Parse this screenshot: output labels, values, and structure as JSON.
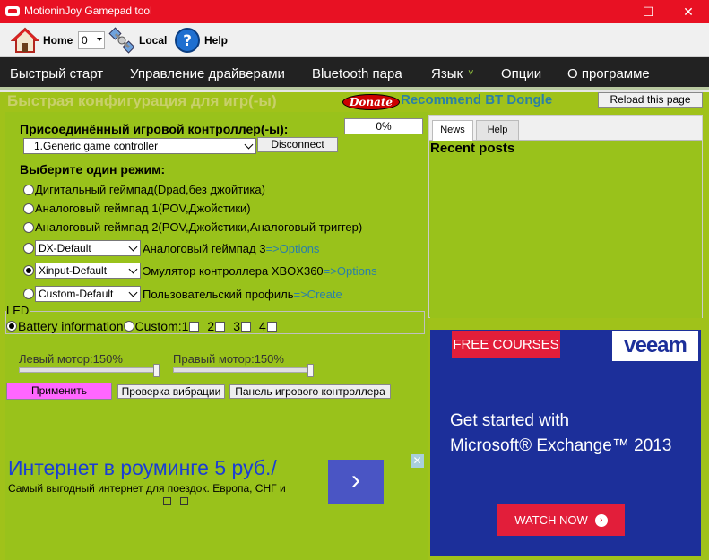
{
  "window": {
    "title": "MotioninJoy Gamepad tool",
    "controls": {
      "minimize": "—",
      "maximize": "☐",
      "close": "✕"
    }
  },
  "toolbar": {
    "home_label": "Home",
    "index_value": "0",
    "local_label": "Local",
    "help_label": "Help"
  },
  "menu": [
    {
      "label": "Быстрый старт"
    },
    {
      "label": "Управление драйверами"
    },
    {
      "label": "Bluetooth пара"
    },
    {
      "label": "Язык"
    },
    {
      "label": "Опции"
    },
    {
      "label": "О программе"
    }
  ],
  "header": {
    "heading": "Быстрая конфигурация для игр(-ы)",
    "donate_label": "Donate",
    "recommend_label": "Recommend BT Dongle",
    "reload_label": "Reload this page"
  },
  "controller": {
    "section_label": "Присоединённый игровой контроллер(-ы):",
    "selected": "1.Generic game controller",
    "disconnect_label": "Disconnect",
    "progress_percent": 0,
    "progress_text": "0%"
  },
  "mode": {
    "section_label": "Выберите один режим:",
    "options": [
      {
        "label": "Дигитальный геймпад(Dpad,без джойтика)",
        "checked": false
      },
      {
        "label": "Аналоговый геймпад 1(POV,Джойстики)",
        "checked": false
      },
      {
        "label": "Аналоговый геймпад 2(POV,Джойстики,Аналоговый триггер)",
        "checked": false
      }
    ],
    "dx": {
      "select": "DX-Default",
      "label": "Аналоговый геймпад 3",
      "link": "=>Options",
      "checked": false
    },
    "xinput": {
      "select": "Xinput-Default",
      "label": "Эмулятор контроллера XBOX360",
      "link": "=>Options",
      "checked": true
    },
    "custom": {
      "select": "Custom-Default",
      "label": "Пользовательский профиль",
      "link": "=>Create",
      "checked": false
    }
  },
  "led": {
    "title": "LED",
    "battery_label": "Battery information",
    "custom_label": "Custom:",
    "slots": [
      "1",
      "2",
      "3",
      "4"
    ]
  },
  "motors": {
    "left_label": "Левый мотор:150%",
    "right_label": "Правый мотор:150%",
    "left_level": 1.0,
    "right_level": 1.0
  },
  "actions": {
    "apply_label": "Применить",
    "vibration_label": "Проверка вибрации",
    "panel_label": "Панель игрового контроллера"
  },
  "ad_left": {
    "title": "Интернет в роуминге 5 руб./",
    "subtitle": "Самый выгодный интернет для поездок. Европа, СНГ и",
    "arrow": "›",
    "close": "✕"
  },
  "news": {
    "tabs": [
      {
        "label": "News"
      },
      {
        "label": "Help"
      }
    ],
    "recent_title": "Recent posts"
  },
  "ad_right": {
    "badge": "FREE COURSES",
    "brand": "veeam",
    "line1": "Get started with",
    "line2": "Microsoft® Exchange™ 2013",
    "cta": "WATCH NOW",
    "close": "✕"
  },
  "colors": {
    "titlebar": "#e81123",
    "panel_green": "#99c21b",
    "menubar": "#222222",
    "link_blue": "#2a7fa8",
    "apply_pink": "#ff66ff",
    "ad_blue": "#1c2f9a",
    "ad_red": "#e21e3a"
  },
  "icons": {
    "home": "home-icon",
    "local": "satellite-icon",
    "help": "help-circle-icon",
    "language": "chevron-down-icon"
  }
}
